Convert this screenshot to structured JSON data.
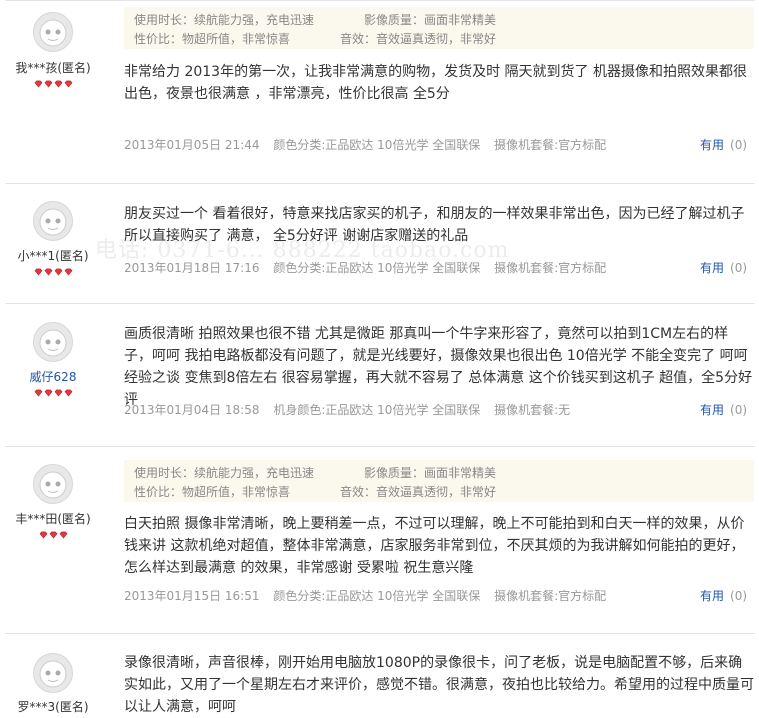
{
  "watermark": "电话: 0371-6... 888222 taobao.com",
  "useful_label": "有用",
  "reviews": [
    {
      "username": "我***孩(匿名)",
      "gem_count": 4,
      "tags": [
        {
          "label": "使用时长：续航能力强，充电迅速",
          "label2": "影像质量：画面非常精美"
        },
        {
          "label": "性价比：物超所值，非常惊喜",
          "label2": "音效：音效逼真透彻，非常好"
        }
      ],
      "content": "非常给力 2013年的第一次，让我非常满意的购物，发货及时 隔天就到货了 机器摄像和拍照效果都很出色，夜景也很满意 ，非常漂亮，性价比很高 全5分",
      "date": "2013年01月05日 21:44",
      "attr1": "颜色分类:正品欧达 10倍光学 全国联保",
      "attr2": "摄像机套餐:官方标配",
      "useful_count": "(0)"
    },
    {
      "username": "小***1(匿名)",
      "gem_count": 4,
      "tags": null,
      "content": "朋友买过一个 看着很好，特意来找店家买的机子，和朋友的一样效果非常出色，因为已经了解过机子所以直接购买了 满意， 全5分好评 谢谢店家赠送的礼品",
      "date": "2013年01月18日 17:16",
      "attr1": "颜色分类:正品欧达 10倍光学 全国联保",
      "attr2": "摄像机套餐:官方标配",
      "useful_count": "(0)"
    },
    {
      "username": "威仔628",
      "gem_count": 4,
      "tags": null,
      "content": "画质很清晰 拍照效果也很不错 尤其是微距 那真叫一个牛字来形容了，竟然可以拍到1CM左右的样子，呵呵   我拍电路板都没有问题了，就是光线要好，摄像效果也很出色 10倍光学 不能全变完了 呵呵经验之谈 变焦到8倍左右 很容易掌握，再大就不容易了 总体满意 这个价钱买到这机子 超值，全5分好评",
      "date": "2013年01月04日 18:58",
      "attr1": "机身颜色:正品欧达 10倍光学 全国联保",
      "attr2": "摄像机套餐:无",
      "useful_count": "(0)"
    },
    {
      "username": "丰***田(匿名)",
      "gem_count": 3,
      "tags": [
        {
          "label": "使用时长：续航能力强，充电迅速",
          "label2": "影像质量：画面非常精美"
        },
        {
          "label": "性价比：物超所值，非常惊喜",
          "label2": "音效：音效逼真透彻，非常好"
        }
      ],
      "content": "白天拍照 摄像非常清晰，晚上要稍差一点，不过可以理解，晚上不可能拍到和白天一样的效果，从价钱来讲 这款机绝对超值，整体非常满意，店家服务非常到位，不厌其烦的为我讲解如何能拍的更好，怎么样达到最满意 的效果，非常感谢 受累啦   祝生意兴隆",
      "date": "2013年01月15日 16:51",
      "attr1": "颜色分类:正品欧达 10倍光学 全国联保",
      "attr2": "摄像机套餐:官方标配",
      "useful_count": "(0)"
    },
    {
      "username": "罗***3(匿名)",
      "gem_count": 4,
      "tags": null,
      "content": "录像很清晰，声音很棒，刚开始用电脑放1080P的录像很卡，问了老板，说是电脑配置不够，后来确实如此，又用了一个星期左右才来评价，感觉不错。很满意，夜拍也比较给力。希望用的过程中质量可以让人满意，呵呵",
      "date": "",
      "attr1": "",
      "attr2": "",
      "useful_count": ""
    }
  ]
}
